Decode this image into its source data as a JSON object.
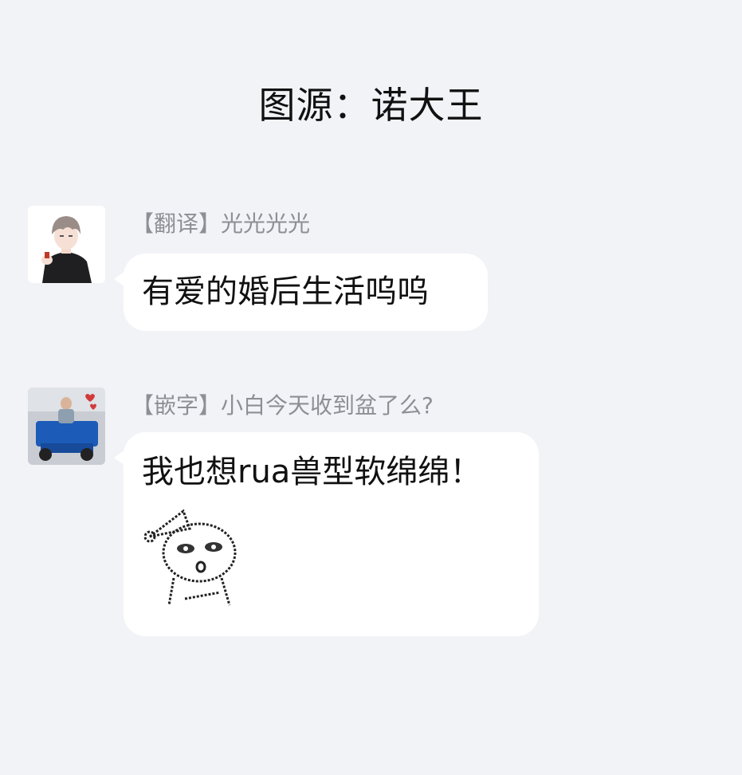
{
  "header": {
    "title": "图源：诺大王"
  },
  "messages": [
    {
      "sender": "【翻译】光光光光",
      "avatar": "avatar-anime-boy",
      "text": "有爱的婚后生活呜呜"
    },
    {
      "sender": "【嵌字】小白今天收到盆了么?",
      "avatar": "avatar-tricycle-rider",
      "text": "我也想rua兽型软绵绵！",
      "sticker": "doodle-face-sticker"
    }
  ]
}
